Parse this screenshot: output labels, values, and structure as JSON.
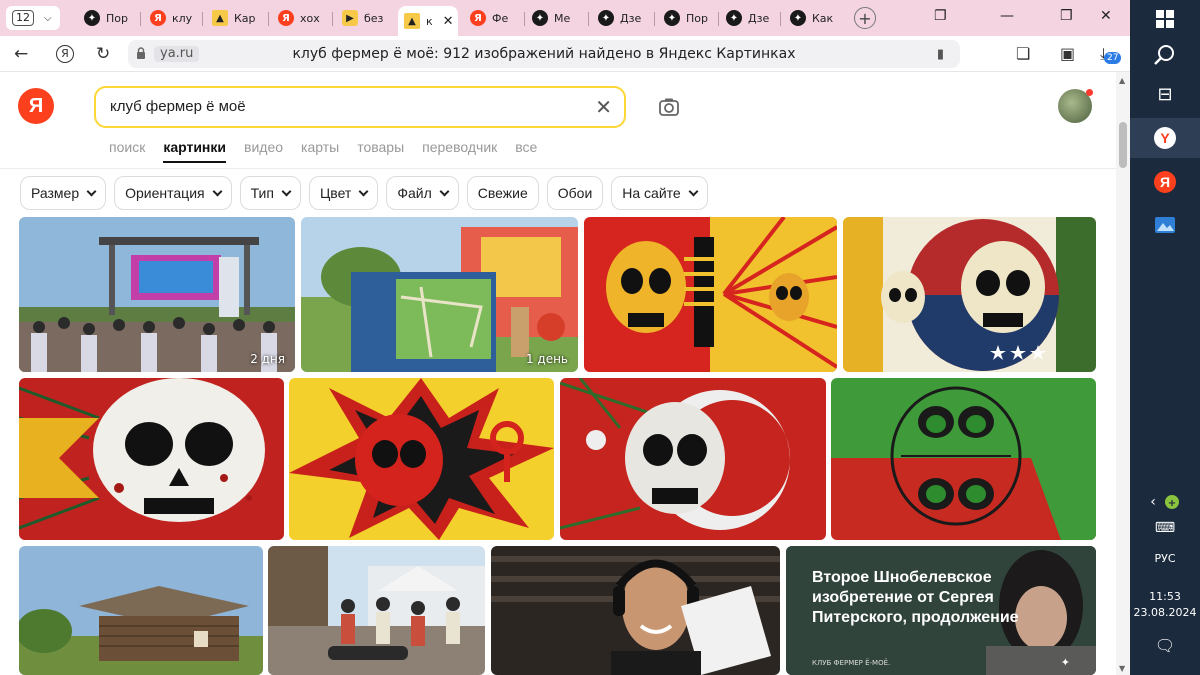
{
  "browser": {
    "tab_count": "12",
    "tabs": [
      {
        "label": "Пор",
        "icon": "dzen-icon"
      },
      {
        "label": "клу",
        "icon": "yandex-icon"
      },
      {
        "label": "Кар",
        "icon": "yandex-images-icon"
      },
      {
        "label": "хох",
        "icon": "yandex-icon"
      },
      {
        "label": "без",
        "icon": "play-icon"
      },
      {
        "label": "к",
        "icon": "yandex-images-icon",
        "active": true
      },
      {
        "label": "Фе",
        "icon": "yandex-icon"
      },
      {
        "label": "Ме",
        "icon": "dzen-icon"
      },
      {
        "label": "Дзе",
        "icon": "dzen-icon"
      },
      {
        "label": "Пор",
        "icon": "dzen-icon"
      },
      {
        "label": "Дзе",
        "icon": "dzen-icon"
      },
      {
        "label": "Как",
        "icon": "dzen-icon"
      }
    ],
    "url_domain": "ya.ru",
    "page_title": "клуб фермер ё моё: 912 изображений найдено в Яндекс Картинках",
    "downloads_badge": "27"
  },
  "header": {
    "logo": "Я",
    "search_query": "клуб фермер ё моё",
    "service_tabs": [
      "поиск",
      "картинки",
      "видео",
      "карты",
      "товары",
      "переводчик",
      "все"
    ],
    "active_service": "картинки"
  },
  "filters": [
    {
      "label": "Размер",
      "dropdown": true
    },
    {
      "label": "Ориентация",
      "dropdown": true
    },
    {
      "label": "Тип",
      "dropdown": true
    },
    {
      "label": "Цвет",
      "dropdown": true
    },
    {
      "label": "Файл",
      "dropdown": true
    },
    {
      "label": "Свежие",
      "dropdown": false
    },
    {
      "label": "Обои",
      "dropdown": false
    },
    {
      "label": "На сайте",
      "dropdown": true
    }
  ],
  "results": {
    "row1": [
      {
        "kind": "photo-festival-stage",
        "age": "2 дня"
      },
      {
        "kind": "photo-park-map",
        "age": "1 день"
      },
      {
        "kind": "skull-yellow-red-sunburst"
      },
      {
        "kind": "skull-tricolor"
      }
    ],
    "row2": [
      {
        "kind": "skull-red-leaves"
      },
      {
        "kind": "skull-yellow-flame"
      },
      {
        "kind": "skull-crescent-red"
      },
      {
        "kind": "skull-green-red"
      }
    ],
    "row3": [
      {
        "kind": "photo-wooden-house"
      },
      {
        "kind": "photo-pirate-festival"
      },
      {
        "kind": "photo-man-headphones"
      },
      {
        "kind": "ad-card",
        "text": "Второе Шнобелевское изобретение от Сергея Питерского, продолжение",
        "caption": "КЛУБ ФЕРМЕР Ё-МОЁ."
      }
    ]
  },
  "taskbar": {
    "language": "РУС",
    "time": "11:53",
    "date": "23.08.2024"
  },
  "colors": {
    "tab_strip": "#f3d4e0",
    "yandex_red": "#fc3f1d",
    "search_border": "#fdd736",
    "taskbar": "#1b2a3d"
  }
}
